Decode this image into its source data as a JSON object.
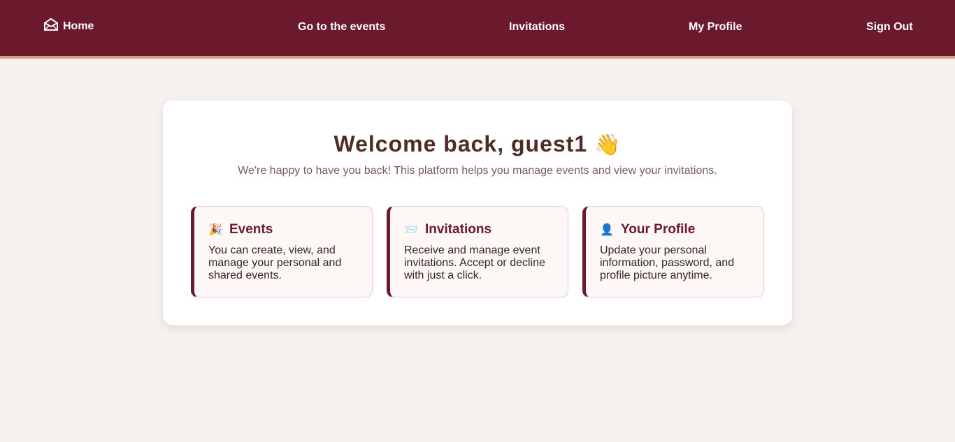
{
  "nav": {
    "home_label": "Home",
    "links": [
      "Go to the events",
      "Invitations",
      "My Profile",
      "Sign Out"
    ]
  },
  "welcome": {
    "title": "Welcome back, guest1",
    "wave_emoji": "👋",
    "subtitle": "We're happy to have you back! This platform helps you manage events and view your invitations."
  },
  "features": [
    {
      "emoji": "🎉",
      "title": "Events",
      "text": "You can create, view, and manage your personal and shared events."
    },
    {
      "emoji": "📨",
      "title": "Invitations",
      "text": "Receive and manage event invitations. Accept or decline with just a click."
    },
    {
      "emoji": "👤",
      "title": "Your Profile",
      "text": "Update your personal information, password, and profile picture anytime."
    }
  ],
  "colors": {
    "navbar": "#6b1a2e",
    "navbar_border": "#c9a27e",
    "background": "#f6f1ee",
    "accent": "#6b1a2e"
  }
}
